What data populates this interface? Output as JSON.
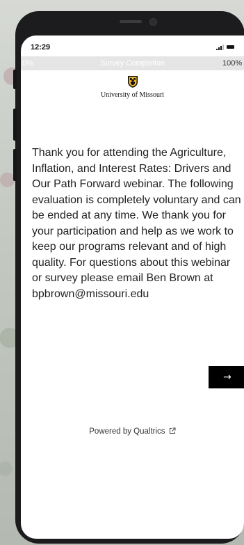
{
  "status_bar": {
    "time": "12:29",
    "signal_icon": "signal-icon",
    "battery_icon": "battery-icon"
  },
  "progress": {
    "start_label": "0%",
    "title": "Survey Completion",
    "end_label": "100%",
    "completion": 0
  },
  "header": {
    "logo_icon": "university-shield-logo-icon",
    "university_name": "University of Missouri",
    "logo_color": "#f1b82d"
  },
  "main": {
    "intro_text": "Thank you for attending the Agriculture, Inflation, and Interest Rates: Drivers and Our Path Forward webinar. The following evaluation is completely voluntary and can be ended at any time. We thank you for your participation and help as we work to keep our programs relevant and of high quality. For questions about this webinar or survey please email Ben Brown at bpbrown@missouri.edu",
    "next_label": "→"
  },
  "footer": {
    "powered_by": "Powered by Qualtrics",
    "external_link_icon": "external-link-icon"
  }
}
